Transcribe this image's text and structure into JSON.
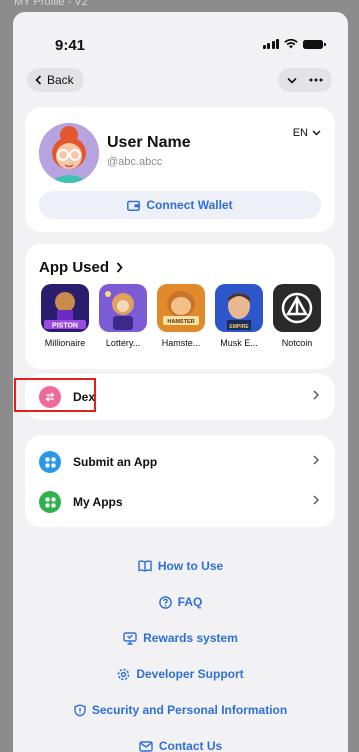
{
  "frame_label": "MY Profile - V2",
  "status_bar": {
    "time": "9:41"
  },
  "nav": {
    "back_label": "Back",
    "menu_chevron": "⌄",
    "menu_more": "•••"
  },
  "profile": {
    "user_name": "User Name",
    "handle": "@abc.abcc",
    "language": "EN",
    "connect_wallet_label": "Connect Wallet"
  },
  "app_used": {
    "title": "App Used",
    "apps": [
      {
        "label": "Millionaire",
        "icon": "piston-app-icon",
        "color": "#2b1d6e"
      },
      {
        "label": "Lottery...",
        "icon": "lottery-app-icon",
        "color": "#7b5bd6"
      },
      {
        "label": "Hamste...",
        "icon": "hamster-kombat-icon",
        "color": "#e08a2c"
      },
      {
        "label": "Musk E...",
        "icon": "musk-empire-icon",
        "color": "#2c56c9"
      },
      {
        "label": "Notcoin",
        "icon": "notcoin-icon",
        "color": "#2a2a2a"
      }
    ]
  },
  "dex": {
    "label": "Dex",
    "icon_color": "#ee6a9a"
  },
  "my_apps_list": [
    {
      "label": "Submit an App",
      "icon_color": "#2b97e8"
    },
    {
      "label": "My Apps",
      "icon_color": "#2fb24b"
    }
  ],
  "footer_links": [
    {
      "label": "How to Use",
      "icon": "book-icon"
    },
    {
      "label": "FAQ",
      "icon": "question-icon"
    },
    {
      "label": "Rewards system",
      "icon": "rewards-icon"
    },
    {
      "label": "Developer Support",
      "icon": "gear-icon"
    },
    {
      "label": "Security and Personal Information",
      "icon": "shield-icon"
    },
    {
      "label": "Contact Us",
      "icon": "mail-icon"
    }
  ],
  "colors": {
    "accent": "#2f6fd8",
    "highlight_border": "#e02020",
    "background": "#f2f2f4"
  }
}
